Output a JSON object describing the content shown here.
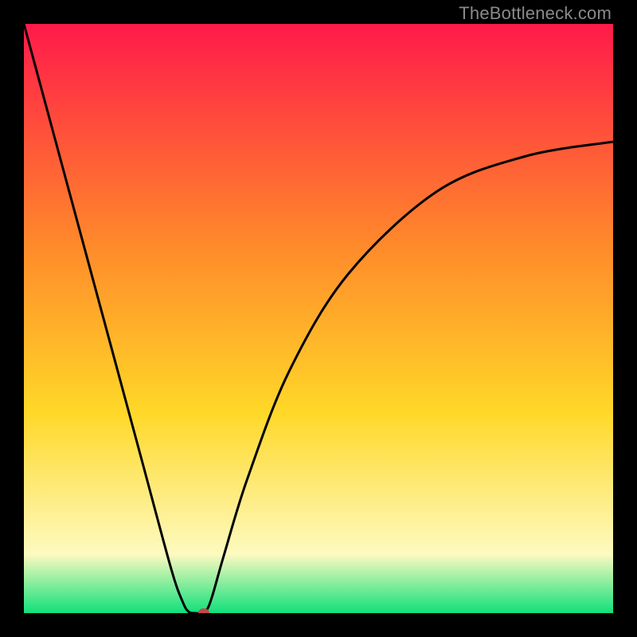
{
  "watermark": "TheBottleneck.com",
  "colors": {
    "top": "#ff1a4a",
    "mid1": "#ff8b2a",
    "mid2": "#ffd828",
    "pale": "#fdfac0",
    "bottom": "#10e07a",
    "stroke": "#000000",
    "dot": "#c24a45",
    "frame": "#000000"
  },
  "chart_data": {
    "type": "line",
    "title": "",
    "xlabel": "",
    "ylabel": "",
    "x": [
      0,
      5,
      10,
      15,
      20,
      25,
      27,
      28,
      29,
      30,
      31,
      32,
      34,
      38,
      45,
      55,
      70,
      85,
      100
    ],
    "values": [
      100,
      81.5,
      63,
      44.5,
      26,
      7.5,
      1.8,
      0.2,
      0,
      0,
      0.5,
      3,
      10,
      23,
      41,
      57.5,
      71.5,
      77.5,
      80
    ],
    "xlim": [
      0,
      100
    ],
    "ylim": [
      0,
      100
    ],
    "annotations": [
      {
        "type": "marker",
        "x": 30.5,
        "y": 0
      }
    ],
    "note": "axes not shown; values estimated from curve geometry"
  }
}
